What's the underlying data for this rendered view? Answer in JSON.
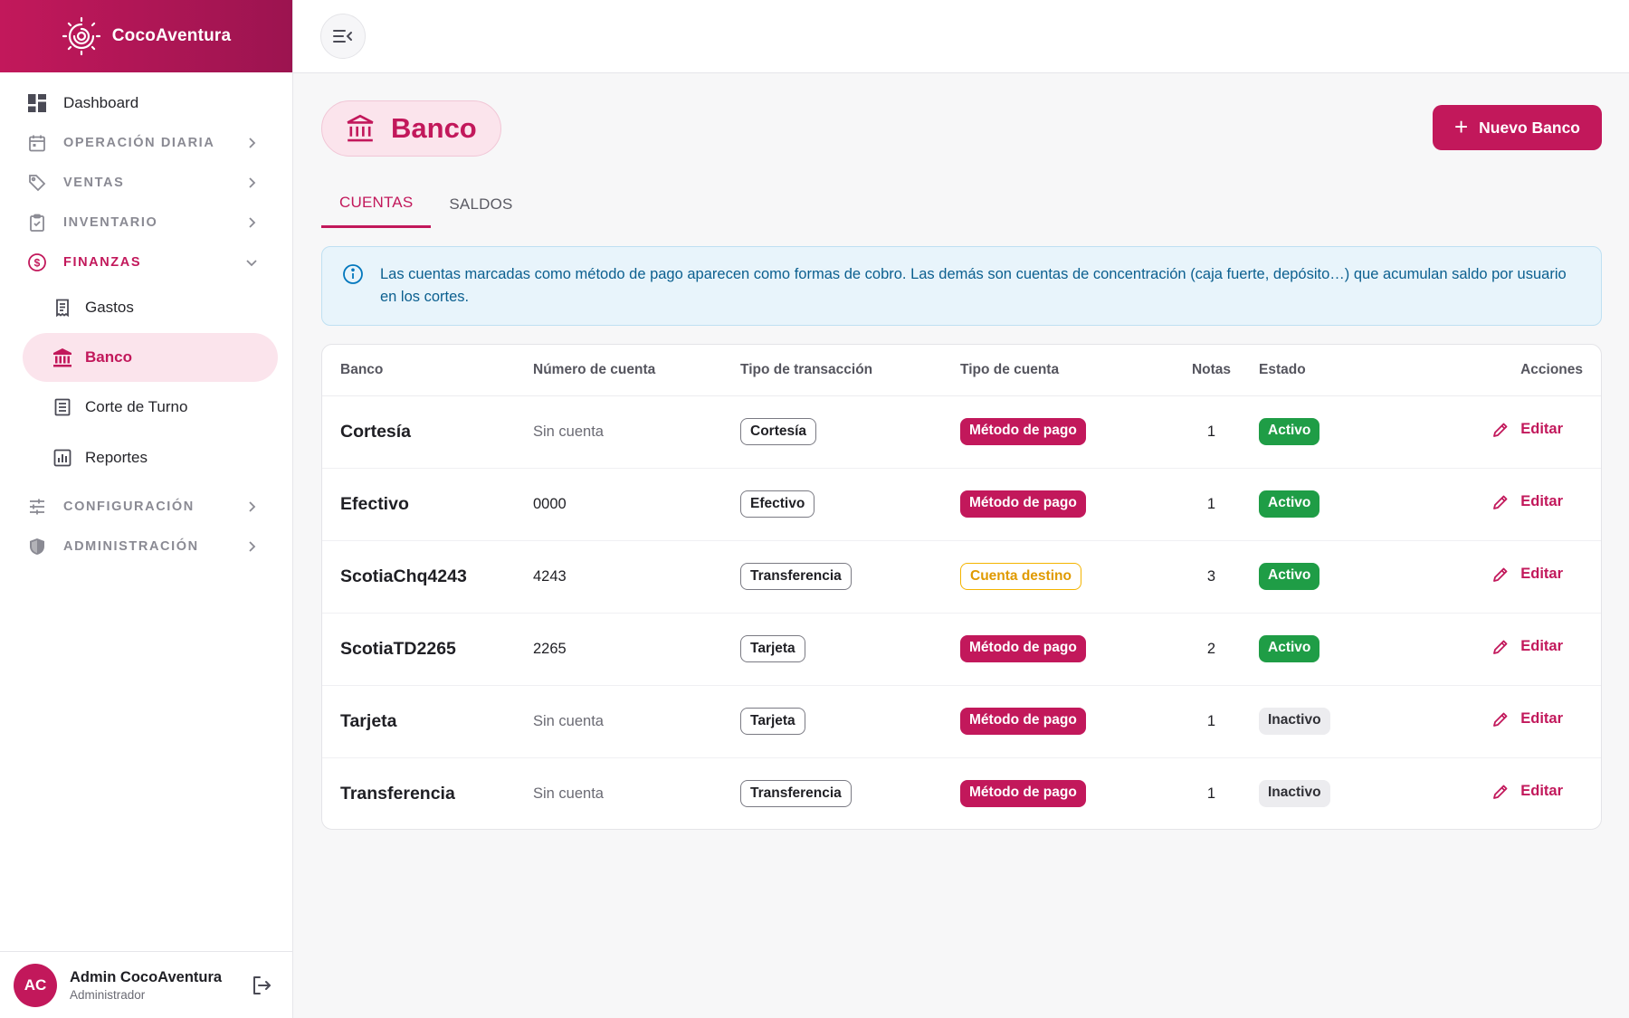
{
  "app": {
    "name": "CocoAventura"
  },
  "sidebar": {
    "items": [
      {
        "label": "Dashboard",
        "icon": "dashboard-icon"
      },
      {
        "label": "OPERACIÓN DIARIA",
        "icon": "calendar-icon"
      },
      {
        "label": "VENTAS",
        "icon": "tag-icon"
      },
      {
        "label": "INVENTARIO",
        "icon": "clipboard-icon"
      },
      {
        "label": "FINANZAS",
        "icon": "dollar-circle-icon"
      },
      {
        "label": "Gastos",
        "icon": "receipt-icon"
      },
      {
        "label": "Banco",
        "icon": "bank-icon"
      },
      {
        "label": "Corte de Turno",
        "icon": "document-icon"
      },
      {
        "label": "Reportes",
        "icon": "bar-chart-icon"
      },
      {
        "label": "CONFIGURACIÓN",
        "icon": "sliders-icon"
      },
      {
        "label": "ADMINISTRACIÓN",
        "icon": "shield-icon"
      }
    ]
  },
  "user": {
    "initials": "AC",
    "name": "Admin CocoAventura",
    "role": "Administrador"
  },
  "page": {
    "title": "Banco",
    "new_button": "Nuevo Banco",
    "tabs": [
      "CUENTAS",
      "SALDOS"
    ],
    "info": "Las cuentas marcadas como método de pago aparecen como formas de cobro. Las demás son cuentas de concentración (caja fuerte, depósito…) que acumulan saldo por usuario en los cortes."
  },
  "table": {
    "headers": [
      "Banco",
      "Número de cuenta",
      "Tipo de transacción",
      "Tipo de cuenta",
      "Notas",
      "Estado",
      "Acciones"
    ],
    "rows": [
      {
        "banco": "Cortesía",
        "numero": "Sin cuenta",
        "tipo": "Cortesía",
        "cuenta": "Método de pago",
        "notas": "1",
        "estado": "Activo",
        "accion": "Editar"
      },
      {
        "banco": "Efectivo",
        "numero": "0000",
        "tipo": "Efectivo",
        "cuenta": "Método de pago",
        "notas": "1",
        "estado": "Activo",
        "accion": "Editar"
      },
      {
        "banco": "ScotiaChq4243",
        "numero": "4243",
        "tipo": "Transferencia",
        "cuenta": "Cuenta destino",
        "notas": "3",
        "estado": "Activo",
        "accion": "Editar"
      },
      {
        "banco": "ScotiaTD2265",
        "numero": "2265",
        "tipo": "Tarjeta",
        "cuenta": "Método de pago",
        "notas": "2",
        "estado": "Activo",
        "accion": "Editar"
      },
      {
        "banco": "Tarjeta",
        "numero": "Sin cuenta",
        "tipo": "Tarjeta",
        "cuenta": "Método de pago",
        "notas": "1",
        "estado": "Inactivo",
        "accion": "Editar"
      },
      {
        "banco": "Transferencia",
        "numero": "Sin cuenta",
        "tipo": "Transferencia",
        "cuenta": "Método de pago",
        "notas": "1",
        "estado": "Inactivo",
        "accion": "Editar"
      }
    ]
  },
  "colors": {
    "accent": "#c2185b",
    "success": "#1f9d46",
    "warning": "#f4b400",
    "info": "#0277bd"
  }
}
